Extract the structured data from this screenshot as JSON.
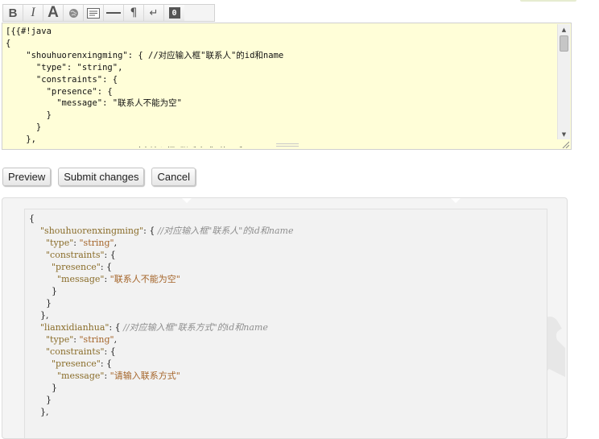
{
  "toolbar": {
    "buttons": [
      {
        "icon": "bold-icon",
        "glyph": "B"
      },
      {
        "icon": "italic-icon",
        "glyph": "I"
      },
      {
        "icon": "font-size-icon",
        "glyph": "A"
      },
      {
        "icon": "globe-link-icon",
        "glyph": ""
      },
      {
        "icon": "image-placeholder-icon",
        "glyph": ""
      },
      {
        "icon": "horizontal-rule-icon",
        "glyph": ""
      },
      {
        "icon": "paragraph-icon",
        "glyph": "¶"
      },
      {
        "icon": "line-break-icon",
        "glyph": "↵"
      },
      {
        "icon": "code-block-icon",
        "glyph": "0"
      }
    ]
  },
  "editor": {
    "content": "[{{#!java\n{\n    \"shouhuorenxingming\": { //对应输入框\"联系人\"的id和name\n      \"type\": \"string\",\n      \"constraints\": {\n        \"presence\": {\n          \"message\": \"联系人不能为空\"\n        }\n      }\n    },\n    \"lianxidianhua\": { //对应输入框\"联系方式\"的id和name"
  },
  "actions": {
    "preview_label": "Preview",
    "submit_label": "Submit changes",
    "cancel_label": "Cancel"
  },
  "preview": {
    "lines": [
      [
        {
          "t": "{",
          "c": "key"
        }
      ],
      [
        {
          "t": "    ",
          "c": "key"
        },
        {
          "t": "\"shouhuorenxingming\"",
          "c": "prop"
        },
        {
          "t": ": { ",
          "c": "key"
        },
        {
          "t": "//对应输入框\"联系人\"的id和name",
          "c": "cmt"
        }
      ],
      [
        {
          "t": "      ",
          "c": "key"
        },
        {
          "t": "\"type\"",
          "c": "prop"
        },
        {
          "t": ": ",
          "c": "key"
        },
        {
          "t": "\"string\"",
          "c": "str"
        },
        {
          "t": ",",
          "c": "key"
        }
      ],
      [
        {
          "t": "      ",
          "c": "key"
        },
        {
          "t": "\"constraints\"",
          "c": "prop"
        },
        {
          "t": ": {",
          "c": "key"
        }
      ],
      [
        {
          "t": "        ",
          "c": "key"
        },
        {
          "t": "\"presence\"",
          "c": "prop"
        },
        {
          "t": ": {",
          "c": "key"
        }
      ],
      [
        {
          "t": "          ",
          "c": "key"
        },
        {
          "t": "\"message\"",
          "c": "prop"
        },
        {
          "t": ": ",
          "c": "key"
        },
        {
          "t": "\"联系人不能为空\"",
          "c": "str"
        }
      ],
      [
        {
          "t": "        }",
          "c": "key"
        }
      ],
      [
        {
          "t": "      }",
          "c": "key"
        }
      ],
      [
        {
          "t": "    },",
          "c": "key"
        }
      ],
      [
        {
          "t": "    ",
          "c": "key"
        },
        {
          "t": "\"lianxidianhua\"",
          "c": "prop"
        },
        {
          "t": ": { ",
          "c": "key"
        },
        {
          "t": "//对应输入框\"联系方式\"的id和name",
          "c": "cmt"
        }
      ],
      [
        {
          "t": "      ",
          "c": "key"
        },
        {
          "t": "\"type\"",
          "c": "prop"
        },
        {
          "t": ": ",
          "c": "key"
        },
        {
          "t": "\"string\"",
          "c": "str"
        },
        {
          "t": ",",
          "c": "key"
        }
      ],
      [
        {
          "t": "      ",
          "c": "key"
        },
        {
          "t": "\"constraints\"",
          "c": "prop"
        },
        {
          "t": ": {",
          "c": "key"
        }
      ],
      [
        {
          "t": "        ",
          "c": "key"
        },
        {
          "t": "\"presence\"",
          "c": "prop"
        },
        {
          "t": ": {",
          "c": "key"
        }
      ],
      [
        {
          "t": "          ",
          "c": "key"
        },
        {
          "t": "\"message\"",
          "c": "prop"
        },
        {
          "t": ": ",
          "c": "key"
        },
        {
          "t": "\"请输入联系方式\"",
          "c": "str"
        }
      ],
      [
        {
          "t": "        }",
          "c": "key"
        }
      ],
      [
        {
          "t": "      }",
          "c": "key"
        }
      ],
      [
        {
          "t": "    },",
          "c": "key"
        }
      ]
    ]
  },
  "colors": {
    "editor_bg": "#fffed8",
    "preview_bg": "#f4f4f4",
    "prop": "#8a6d2a",
    "string": "#a5652a",
    "comment": "#8e8e8e"
  }
}
